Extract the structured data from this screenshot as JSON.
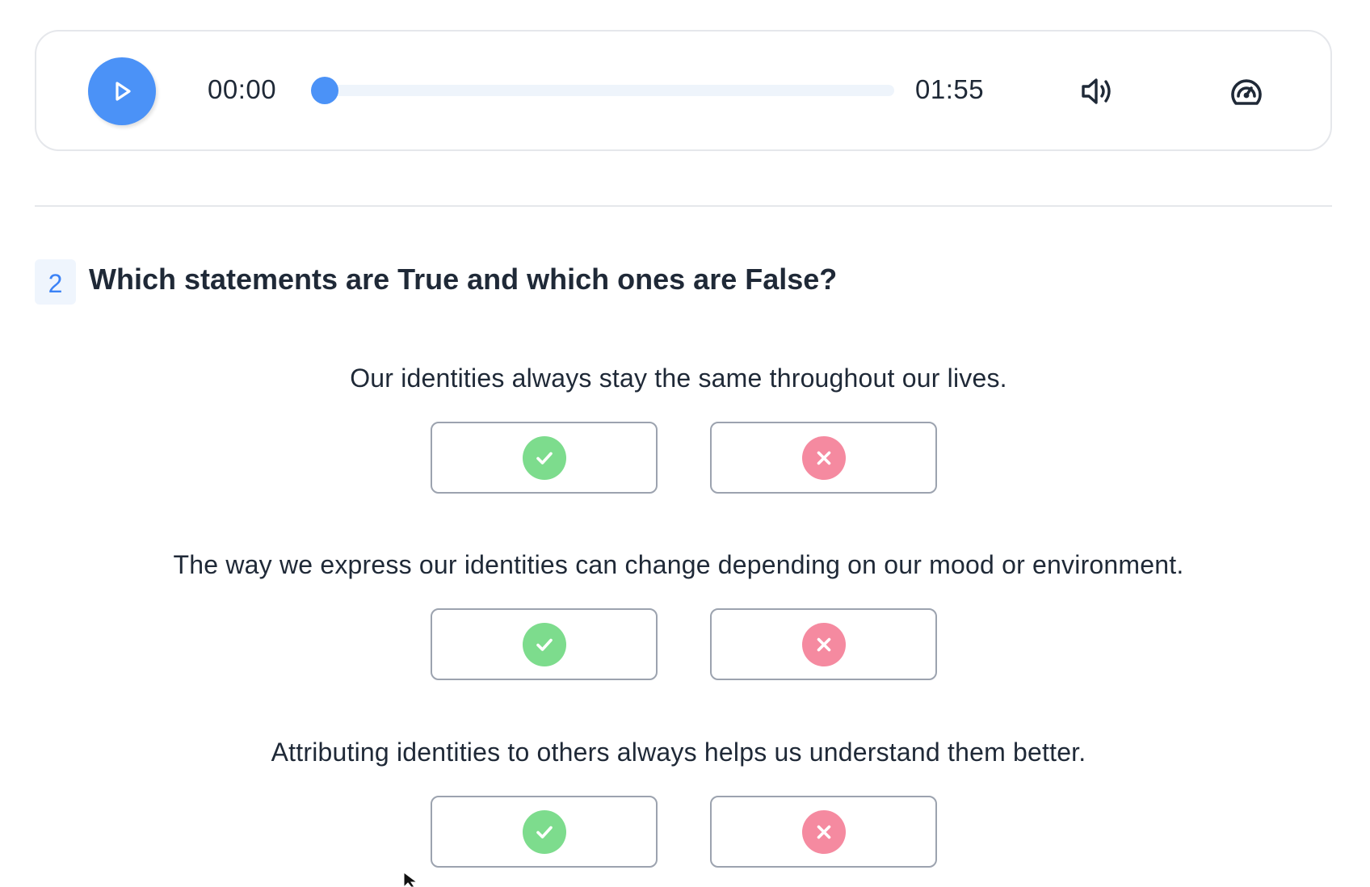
{
  "player": {
    "current_time": "00:00",
    "total_time": "01:55",
    "progress_fraction": 0.0,
    "accent_color": "#4b92f7",
    "icons": {
      "play": "play-icon",
      "volume": "volume-icon",
      "speed": "playback-speed-icon"
    }
  },
  "question": {
    "number": "2",
    "title": "Which statements are True and which ones are False?",
    "statements": [
      {
        "text": "Our identities always stay the same throughout our lives."
      },
      {
        "text": "The way we express our identities can change depending on our mood or environment."
      },
      {
        "text": "Attributing identities to others always helps us understand them better."
      }
    ],
    "true_icon": "check-circle-icon",
    "false_icon": "x-circle-icon",
    "true_color": "#7ddc8d",
    "false_color": "#f58aa0"
  }
}
